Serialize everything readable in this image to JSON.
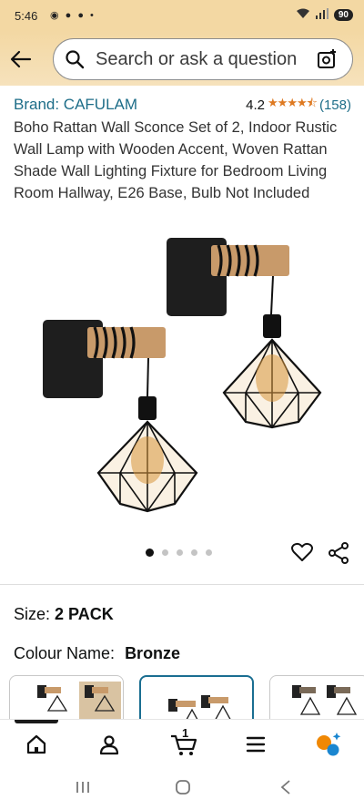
{
  "status_bar": {
    "time": "5:46",
    "battery": "90"
  },
  "header": {
    "back_icon": "arrow-left-icon",
    "search": {
      "placeholder": "Search or ask a question"
    },
    "camera_icon": "camera-scan-icon"
  },
  "product": {
    "brand": "Brand: CAFULAM",
    "rating": "4.2",
    "stars": "★★★★⯪",
    "review_count": "(158)",
    "title": "Boho Rattan Wall Sconce Set of 2, Indoor Rustic Wall Lamp with Wooden Accent, Woven Rattan Shade Wall Lighting Fixture for Bedroom Living Room Hallway, E26 Base, Bulb Not Included",
    "image_count": 5,
    "active_image_index": 0
  },
  "options": {
    "size_label": "Size:",
    "size_value": "2 PACK",
    "colour_label": "Colour Name:",
    "colour_value": "Bronze",
    "swatch_count": 3,
    "selected_swatch_index": 1
  },
  "bottom_nav": {
    "items": [
      "home-icon",
      "account-icon",
      "cart-icon",
      "menu-icon",
      "rufus-assistant-icon"
    ],
    "cart_count": "1"
  },
  "colors": {
    "header_bg": "#f3d8a3",
    "link": "#1d6d88",
    "star": "#de7921",
    "selected_border": "#1a6e91"
  }
}
